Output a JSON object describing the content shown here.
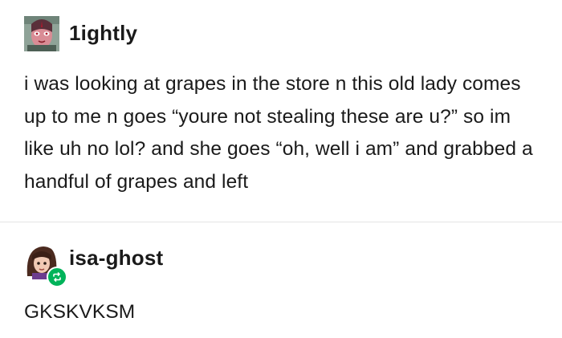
{
  "posts": [
    {
      "username": "1ightly",
      "avatar_icon": "avatar-icon",
      "text": "i was looking at grapes in the store n this old lady comes up to me n goes “youre not stealing these are u?” so im like uh no lol? and she goes “oh, well i am” and grabbed a handful of grapes and left"
    },
    {
      "username": "isa-ghost",
      "avatar_icon": "avatar-icon",
      "badge_icon": "reblog-icon",
      "text": "GKSKVKSM"
    }
  ],
  "colors": {
    "reblog_badge": "#00b35a",
    "divider": "#e4e4e4",
    "text": "#1a1a1a"
  }
}
